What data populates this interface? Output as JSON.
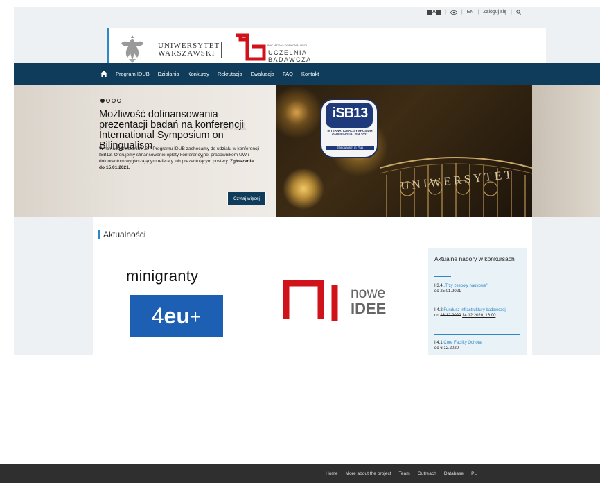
{
  "util": {
    "contrast": "A",
    "lang": "EN",
    "login": "Zaloguj się"
  },
  "header": {
    "uw_name_line1": "UNIWERSYTET",
    "uw_name_line2": "WARSZAWSKI",
    "ub_small": "INICJATYWA DOSKONAŁOŚCI",
    "ub_name_line1": "UCZELNIA",
    "ub_name_line2": "BADAWCZA"
  },
  "nav": {
    "items": [
      "Program IDUB",
      "Działania",
      "Konkursy",
      "Rekrutacja",
      "Ewaluacja",
      "FAQ",
      "Kontakt"
    ]
  },
  "hero": {
    "title": "Możliwość dofinansowania prezentacji badań na konferencji International Symposium on Bilingualism",
    "desc_plain": "W ramach Działania II.3.7 Programu IDUB zachęcamy do udziału w konferencji ISB13. Oferujemy sfinansowanie opłaty konferencyjnej pracownikom UW i doktorantom wygłaszającym referaty lub prezentującym postery. ",
    "desc_bold": "Zgłoszenia do 15.01.2021.",
    "more_button": "Czytaj więcej",
    "badge_letters": "iSB13",
    "badge_line1": "INTERNATIONAL SYMPOSIUM",
    "badge_line2": "ON BILINGUALISM",
    "badge_year": "2021",
    "badge_tag": "Bilingualism in Flux",
    "gate_text": "UNIWERSYTET",
    "ghost_year": "2021"
  },
  "news": {
    "title": "Aktualności",
    "minigranty": "minigranty",
    "eu_four": "4",
    "eu_word": "eu",
    "eu_plus": "+",
    "nowe": "nowe",
    "idee": "IDEE"
  },
  "sidebar": {
    "title": "Aktualne nabory w konkursach",
    "items": [
      {
        "code": "I.3.4",
        "link": "„Trzy zespoły naukowe”",
        "date": "do 25.01.2021"
      },
      {
        "code": "I.4.2",
        "link": "Fundusz infrastruktury badawczej",
        "date_prefix": "do ",
        "date_old": "13.12.2020",
        "date_new": "14.12.2020, 16:00"
      },
      {
        "code": "I.4.1",
        "link": "Core Facility Ochota",
        "date": "do 6.12.2020"
      }
    ]
  },
  "footer": {
    "links": [
      "Home",
      "More about the project",
      "Team",
      "Outreach",
      "Database",
      "PL"
    ]
  }
}
